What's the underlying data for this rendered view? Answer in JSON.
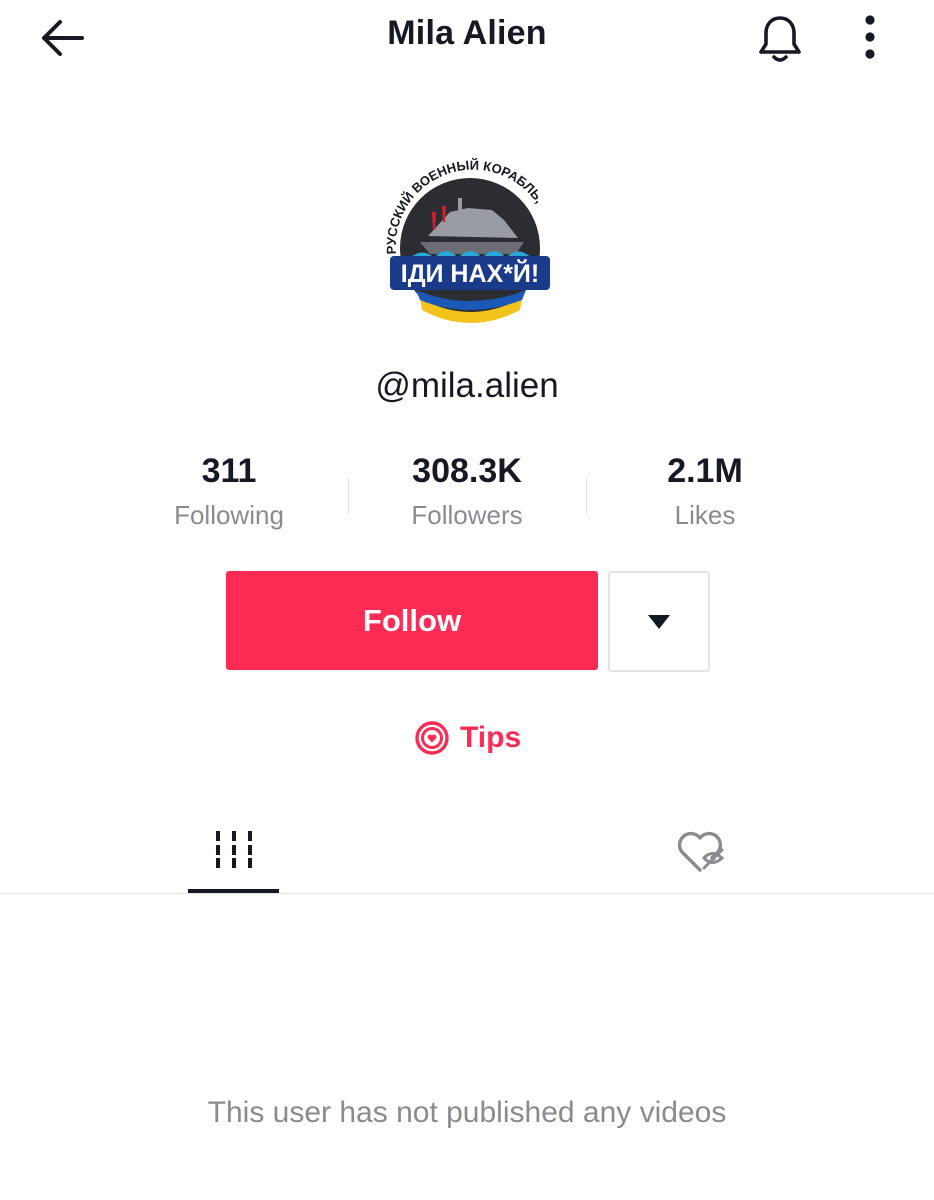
{
  "header": {
    "title": "Mila Alien",
    "back_icon": "arrow-left-icon",
    "bell_icon": "bell-icon",
    "more_icon": "more-vertical-icon"
  },
  "profile": {
    "avatar_text_top": "РУССКИЙ ВОЕННЫЙ КОРАБЛЬ,",
    "avatar_text_main": "ІДИ НАХ*Й!",
    "username": "@mila.alien"
  },
  "stats": [
    {
      "value": "311",
      "label": "Following"
    },
    {
      "value": "308.3K",
      "label": "Followers"
    },
    {
      "value": "2.1M",
      "label": "Likes"
    }
  ],
  "actions": {
    "follow_label": "Follow",
    "dropdown_icon": "caret-down-icon",
    "tips_label": "Tips",
    "tips_icon": "tips-heart-icon"
  },
  "tabs": [
    {
      "icon": "videos-grid-icon",
      "active": true
    },
    {
      "icon": "liked-hidden-icon",
      "active": false
    }
  ],
  "empty_state": {
    "message": "This user has not published any videos"
  },
  "colors": {
    "accent": "#fe2c55",
    "text_primary": "#161823",
    "text_secondary": "#8a8b91",
    "divider": "#e3e3e4"
  }
}
